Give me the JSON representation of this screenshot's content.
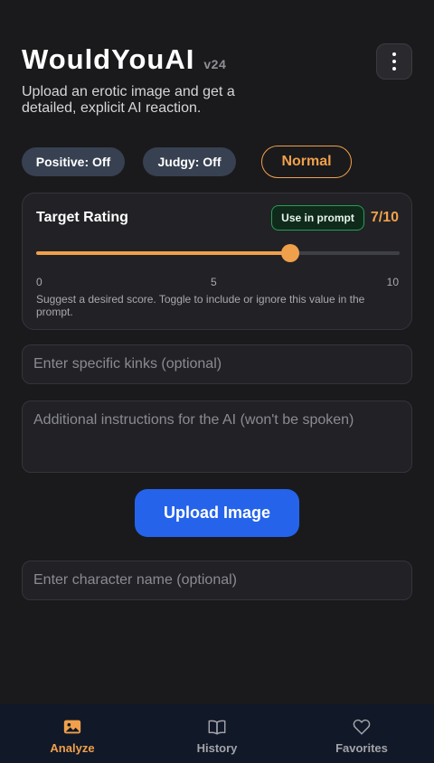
{
  "header": {
    "title": "WouldYouAI",
    "version": "v24",
    "subtitle": "Upload an erotic image and get a detailed, explicit AI reaction.",
    "menu_icon": "kebab-menu-icon"
  },
  "toggles": {
    "positive_label": "Positive: Off",
    "judgy_label": "Judgy: Off",
    "mode_label": "Normal"
  },
  "rating": {
    "title": "Target Rating",
    "use_in_prompt_label": "Use in prompt",
    "display": "7/10",
    "value": 7,
    "min": 0,
    "mid": 5,
    "max": 10,
    "min_label": "0",
    "mid_label": "5",
    "max_label": "10",
    "hint": "Suggest a desired score. Toggle to include or ignore this value in the prompt."
  },
  "inputs": {
    "kinks_placeholder": "Enter specific kinks (optional)",
    "kinks_value": "",
    "instructions_placeholder": "Additional instructions for the AI (won't be spoken)",
    "instructions_value": "",
    "character_placeholder": "Enter character name (optional)",
    "character_value": ""
  },
  "upload_button": {
    "label": "Upload Image"
  },
  "nav": {
    "items": [
      {
        "label": "Analyze",
        "icon": "image-icon",
        "active": true
      },
      {
        "label": "History",
        "icon": "book-icon",
        "active": false
      },
      {
        "label": "Favorites",
        "icon": "heart-icon",
        "active": false
      }
    ]
  },
  "colors": {
    "accent": "#f0a04b",
    "primary": "#2563eb",
    "success_border": "#22a055",
    "background": "#1a1a1c",
    "nav_background": "#111827"
  }
}
